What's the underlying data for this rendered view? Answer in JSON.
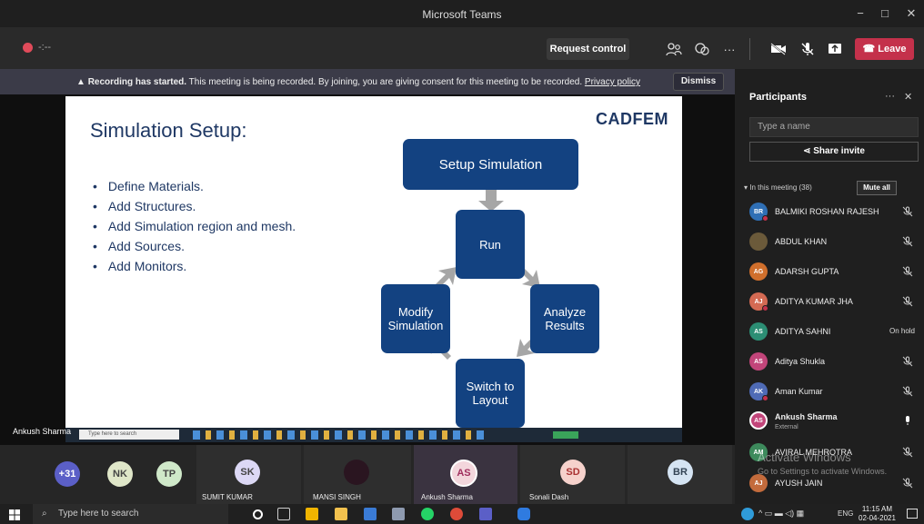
{
  "window": {
    "title": "Microsoft Teams",
    "min": "−",
    "max": "□",
    "close": "✕"
  },
  "toolbar": {
    "timer": "-:--",
    "request_control": "Request control",
    "more": "···",
    "leave": "Leave",
    "accent": "#c4314b"
  },
  "banner": {
    "bold": "Recording has started.",
    "text": "This meeting is being recorded. By joining, you are giving consent for this meeting to be recorded.",
    "link": "Privacy policy",
    "dismiss": "Dismiss"
  },
  "slide": {
    "title": "Simulation Setup:",
    "logo": "CADFEM",
    "bullets": [
      "Define Materials.",
      "Add Structures.",
      "Add Simulation region and mesh.",
      "Add Sources.",
      "Add Monitors."
    ],
    "boxes": {
      "setup": "Setup Simulation",
      "run": "Run",
      "modify": "Modify Simulation",
      "analyze": "Analyze Results",
      "switch": "Switch to Layout"
    },
    "box_color": "#134281"
  },
  "shared_screen": {
    "search": "Type here to search"
  },
  "speaker": "Ankush Sharma",
  "gallery": [
    {
      "initials": "+31",
      "name": "",
      "color": "#5b5fc7"
    },
    {
      "initials": "NK",
      "name": "",
      "color": "#dfe6c8"
    },
    {
      "initials": "TP",
      "name": "",
      "color": "#cfe8c9"
    },
    {
      "initials": "SK",
      "name": "SUMIT KUMAR",
      "color": "#dcd8f5"
    },
    {
      "initials": "",
      "name": "MANSI SINGH",
      "color": "#2a1520"
    },
    {
      "initials": "AS",
      "name": "Ankush Sharma",
      "color": "#f3d6dc"
    },
    {
      "initials": "SD",
      "name": "Sonali Dash",
      "color": "#f6d2cc"
    },
    {
      "initials": "BR",
      "name": "",
      "color": "#d5e4f3"
    }
  ],
  "participants": {
    "title": "Participants",
    "more": "···",
    "close": "✕",
    "search_placeholder": "Type a name",
    "share_invite": "Share invite",
    "in_meeting": "In this meeting (38)",
    "mute_all": "Mute all",
    "list": [
      {
        "initials": "BR",
        "name": "BALMIKI ROSHAN RAJESH",
        "status": "",
        "color": "#2f6fb5"
      },
      {
        "initials": "",
        "name": "ABDUL KHAN",
        "status": "",
        "color": "#6b5a3a"
      },
      {
        "initials": "AG",
        "name": "ADARSH GUPTA",
        "status": "",
        "color": "#d06f2c"
      },
      {
        "initials": "AJ",
        "name": "ADITYA KUMAR JHA",
        "status": "",
        "color": "#d46a53"
      },
      {
        "initials": "AS",
        "name": "ADITYA SAHNI",
        "status": "On hold",
        "color": "#2c8e74"
      },
      {
        "initials": "AS",
        "name": "Aditya Shukla",
        "status": "",
        "color": "#c2457a"
      },
      {
        "initials": "AK",
        "name": "Aman Kumar",
        "status": "",
        "color": "#4f6bb6"
      },
      {
        "initials": "AS",
        "name": "Ankush Sharma",
        "status": "",
        "ext": "External",
        "color": "#c2457a"
      },
      {
        "initials": "AM",
        "name": "AVIRAL MEHROTRA",
        "status": "",
        "color": "#3d8a5c"
      },
      {
        "initials": "AJ",
        "name": "AYUSH JAIN",
        "status": "",
        "color": "#c36b3c"
      }
    ]
  },
  "watermark": {
    "title": "Activate Windows",
    "sub": "Go to Settings to activate Windows."
  },
  "taskbar": {
    "search": "Type here to search",
    "lang": "ENG",
    "time": "11:15 AM",
    "date": "02-04-2021"
  }
}
